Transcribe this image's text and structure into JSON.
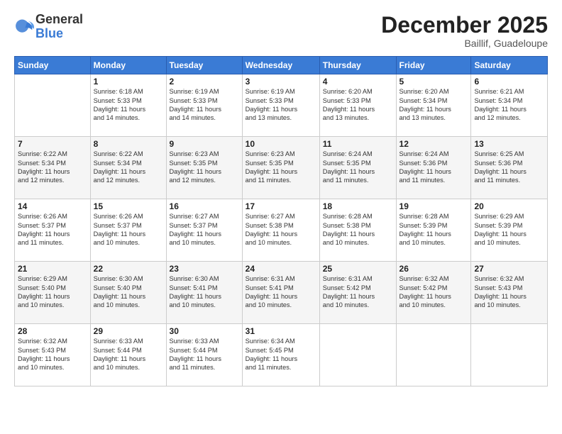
{
  "logo": {
    "general": "General",
    "blue": "Blue"
  },
  "header": {
    "month": "December 2025",
    "location": "Baillif, Guadeloupe"
  },
  "weekdays": [
    "Sunday",
    "Monday",
    "Tuesday",
    "Wednesday",
    "Thursday",
    "Friday",
    "Saturday"
  ],
  "weeks": [
    [
      null,
      {
        "num": "1",
        "sunrise": "6:18 AM",
        "sunset": "5:33 PM",
        "daylight": "11 hours and 14 minutes."
      },
      {
        "num": "2",
        "sunrise": "6:19 AM",
        "sunset": "5:33 PM",
        "daylight": "11 hours and 14 minutes."
      },
      {
        "num": "3",
        "sunrise": "6:19 AM",
        "sunset": "5:33 PM",
        "daylight": "11 hours and 13 minutes."
      },
      {
        "num": "4",
        "sunrise": "6:20 AM",
        "sunset": "5:33 PM",
        "daylight": "11 hours and 13 minutes."
      },
      {
        "num": "5",
        "sunrise": "6:20 AM",
        "sunset": "5:34 PM",
        "daylight": "11 hours and 13 minutes."
      },
      {
        "num": "6",
        "sunrise": "6:21 AM",
        "sunset": "5:34 PM",
        "daylight": "11 hours and 12 minutes."
      }
    ],
    [
      {
        "num": "7",
        "sunrise": "6:22 AM",
        "sunset": "5:34 PM",
        "daylight": "11 hours and 12 minutes."
      },
      {
        "num": "8",
        "sunrise": "6:22 AM",
        "sunset": "5:34 PM",
        "daylight": "11 hours and 12 minutes."
      },
      {
        "num": "9",
        "sunrise": "6:23 AM",
        "sunset": "5:35 PM",
        "daylight": "11 hours and 12 minutes."
      },
      {
        "num": "10",
        "sunrise": "6:23 AM",
        "sunset": "5:35 PM",
        "daylight": "11 hours and 11 minutes."
      },
      {
        "num": "11",
        "sunrise": "6:24 AM",
        "sunset": "5:35 PM",
        "daylight": "11 hours and 11 minutes."
      },
      {
        "num": "12",
        "sunrise": "6:24 AM",
        "sunset": "5:36 PM",
        "daylight": "11 hours and 11 minutes."
      },
      {
        "num": "13",
        "sunrise": "6:25 AM",
        "sunset": "5:36 PM",
        "daylight": "11 hours and 11 minutes."
      }
    ],
    [
      {
        "num": "14",
        "sunrise": "6:26 AM",
        "sunset": "5:37 PM",
        "daylight": "11 hours and 11 minutes."
      },
      {
        "num": "15",
        "sunrise": "6:26 AM",
        "sunset": "5:37 PM",
        "daylight": "11 hours and 10 minutes."
      },
      {
        "num": "16",
        "sunrise": "6:27 AM",
        "sunset": "5:37 PM",
        "daylight": "11 hours and 10 minutes."
      },
      {
        "num": "17",
        "sunrise": "6:27 AM",
        "sunset": "5:38 PM",
        "daylight": "11 hours and 10 minutes."
      },
      {
        "num": "18",
        "sunrise": "6:28 AM",
        "sunset": "5:38 PM",
        "daylight": "11 hours and 10 minutes."
      },
      {
        "num": "19",
        "sunrise": "6:28 AM",
        "sunset": "5:39 PM",
        "daylight": "11 hours and 10 minutes."
      },
      {
        "num": "20",
        "sunrise": "6:29 AM",
        "sunset": "5:39 PM",
        "daylight": "11 hours and 10 minutes."
      }
    ],
    [
      {
        "num": "21",
        "sunrise": "6:29 AM",
        "sunset": "5:40 PM",
        "daylight": "11 hours and 10 minutes."
      },
      {
        "num": "22",
        "sunrise": "6:30 AM",
        "sunset": "5:40 PM",
        "daylight": "11 hours and 10 minutes."
      },
      {
        "num": "23",
        "sunrise": "6:30 AM",
        "sunset": "5:41 PM",
        "daylight": "11 hours and 10 minutes."
      },
      {
        "num": "24",
        "sunrise": "6:31 AM",
        "sunset": "5:41 PM",
        "daylight": "11 hours and 10 minutes."
      },
      {
        "num": "25",
        "sunrise": "6:31 AM",
        "sunset": "5:42 PM",
        "daylight": "11 hours and 10 minutes."
      },
      {
        "num": "26",
        "sunrise": "6:32 AM",
        "sunset": "5:42 PM",
        "daylight": "11 hours and 10 minutes."
      },
      {
        "num": "27",
        "sunrise": "6:32 AM",
        "sunset": "5:43 PM",
        "daylight": "11 hours and 10 minutes."
      }
    ],
    [
      {
        "num": "28",
        "sunrise": "6:32 AM",
        "sunset": "5:43 PM",
        "daylight": "11 hours and 10 minutes."
      },
      {
        "num": "29",
        "sunrise": "6:33 AM",
        "sunset": "5:44 PM",
        "daylight": "11 hours and 10 minutes."
      },
      {
        "num": "30",
        "sunrise": "6:33 AM",
        "sunset": "5:44 PM",
        "daylight": "11 hours and 11 minutes."
      },
      {
        "num": "31",
        "sunrise": "6:34 AM",
        "sunset": "5:45 PM",
        "daylight": "11 hours and 11 minutes."
      },
      null,
      null,
      null
    ]
  ],
  "labels": {
    "sunrise": "Sunrise:",
    "sunset": "Sunset:",
    "daylight": "Daylight:"
  }
}
